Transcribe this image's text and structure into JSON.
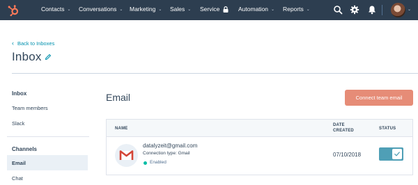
{
  "nav": {
    "items": [
      {
        "label": "Contacts",
        "has_dropdown": true
      },
      {
        "label": "Conversations",
        "has_dropdown": true
      },
      {
        "label": "Marketing",
        "has_dropdown": true
      },
      {
        "label": "Sales",
        "has_dropdown": true
      },
      {
        "label": "Service",
        "locked": true
      },
      {
        "label": "Automation",
        "has_dropdown": true
      },
      {
        "label": "Reports",
        "has_dropdown": true
      }
    ],
    "icons": [
      "search-icon",
      "settings-icon",
      "notifications-icon"
    ],
    "background_color": "#2d3e50",
    "brand_color": "#ff7a59"
  },
  "header": {
    "back_label": "Back to Inboxes",
    "title": "Inbox"
  },
  "sidebar": {
    "inbox_heading": "Inbox",
    "inbox_items": [
      "Team members",
      "Slack"
    ],
    "channels_heading": "Channels",
    "channel_items": [
      "Email",
      "Chat"
    ],
    "active_item": "Email"
  },
  "main": {
    "section_title": "Email",
    "connect_button_label": "Connect team email",
    "accent_color": "#e68c77",
    "table": {
      "columns": [
        "NAME",
        "DATE CREATED",
        "STATUS"
      ],
      "rows": [
        {
          "email": "datalyzeit@gmail.com",
          "connection_type": "Connection type: Gmail",
          "status": "Enabled",
          "date_created": "07/10/2018",
          "toggle_on": true
        }
      ]
    }
  }
}
